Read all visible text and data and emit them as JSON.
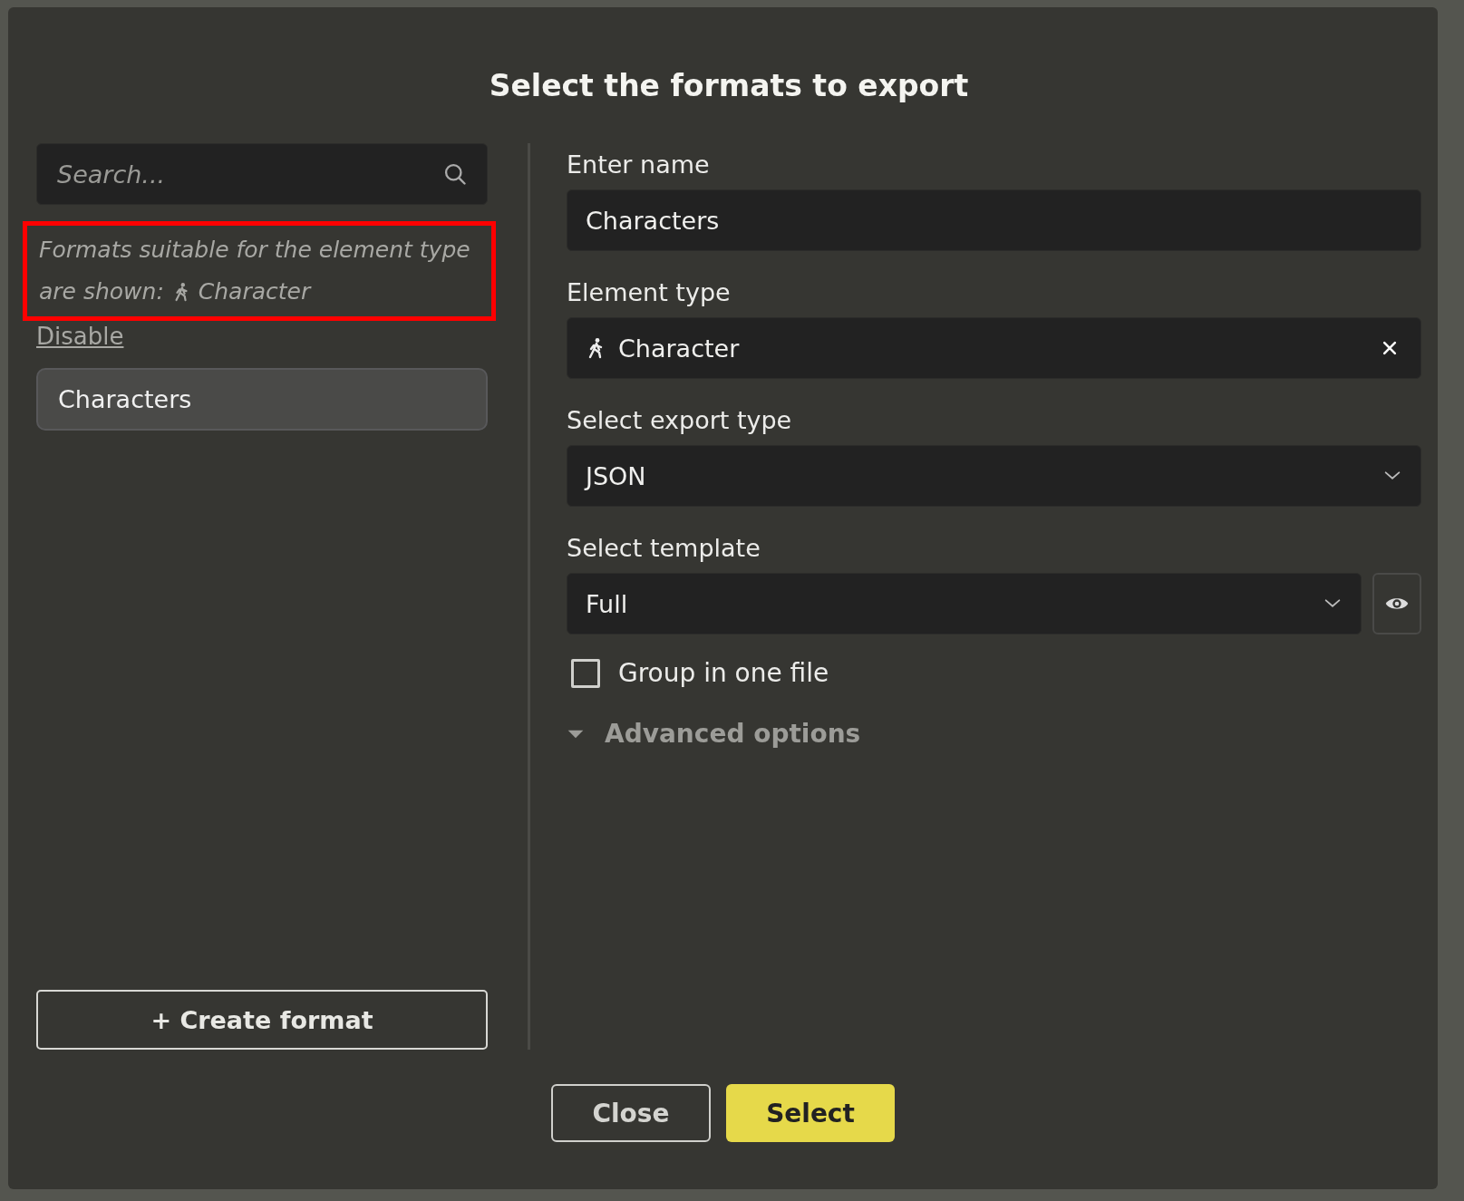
{
  "dialog": {
    "title": "Select the formats to export"
  },
  "search": {
    "placeholder": "Search..."
  },
  "filter_notice": {
    "lines": [
      "Formats suitable for the element type",
      "are shown:"
    ],
    "element_type": "Character",
    "highlighted": true
  },
  "disable_link": "Disable",
  "formats": [
    {
      "label": "Characters",
      "selected": true
    }
  ],
  "create_button": "+ Create format",
  "form": {
    "name": {
      "label": "Enter name",
      "value": "Characters"
    },
    "element_type": {
      "label": "Element type",
      "value": "Character"
    },
    "export_type": {
      "label": "Select export type",
      "value": "JSON"
    },
    "template": {
      "label": "Select template",
      "value": "Full"
    },
    "group_in_one_file": {
      "label": "Group in one file",
      "checked": false
    },
    "advanced_options": {
      "label": "Advanced options"
    }
  },
  "buttons": [
    {
      "label": "Close",
      "kind": "secondary"
    },
    {
      "label": "Select",
      "kind": "primary"
    }
  ]
}
